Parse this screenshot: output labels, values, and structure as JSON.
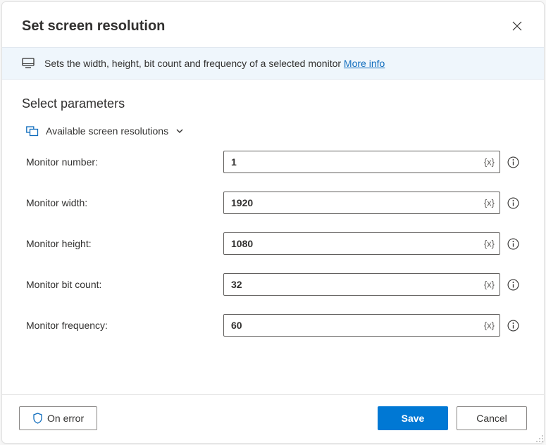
{
  "header": {
    "title": "Set screen resolution"
  },
  "banner": {
    "text": "Sets the width, height, bit count and frequency of a selected monitor ",
    "link": "More info"
  },
  "section": {
    "title": "Select parameters",
    "variables_label": "Available screen resolutions"
  },
  "fields": {
    "monitor_number": {
      "label": "Monitor number:",
      "value": "1"
    },
    "monitor_width": {
      "label": "Monitor width:",
      "value": "1920"
    },
    "monitor_height": {
      "label": "Monitor height:",
      "value": "1080"
    },
    "monitor_bit_count": {
      "label": "Monitor bit count:",
      "value": "32"
    },
    "monitor_frequency": {
      "label": "Monitor frequency:",
      "value": "60"
    }
  },
  "var_badge": "{x}",
  "buttons": {
    "on_error": "On error",
    "save": "Save",
    "cancel": "Cancel"
  }
}
